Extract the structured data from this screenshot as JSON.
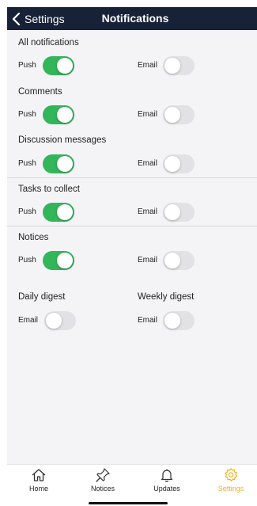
{
  "header": {
    "back_label": "Settings",
    "title": "Notifications"
  },
  "sections": [
    {
      "title": "All notifications",
      "left": {
        "label": "Push",
        "on": true
      },
      "right": {
        "label": "Email",
        "on": false
      }
    },
    {
      "title": "Comments",
      "left": {
        "label": "Push",
        "on": true
      },
      "right": {
        "label": "Email",
        "on": false
      }
    },
    {
      "title": "Discussion messages",
      "left": {
        "label": "Push",
        "on": true
      },
      "right": {
        "label": "Email",
        "on": false
      }
    },
    {
      "title": "Tasks to collect",
      "left": {
        "label": "Push",
        "on": true
      },
      "right": {
        "label": "Email",
        "on": false
      }
    },
    {
      "title": "Notices",
      "left": {
        "label": "Push",
        "on": true
      },
      "right": {
        "label": "Email",
        "on": false
      }
    }
  ],
  "digest": {
    "daily": {
      "title": "Daily digest",
      "label": "Email",
      "on": false
    },
    "weekly": {
      "title": "Weekly digest",
      "label": "Email",
      "on": false
    }
  },
  "tabbar": [
    {
      "label": "Home",
      "icon": "home-icon",
      "active": false
    },
    {
      "label": "Notices",
      "icon": "pin-icon",
      "active": false
    },
    {
      "label": "Updates",
      "icon": "bell-icon",
      "active": false
    },
    {
      "label": "Settings",
      "icon": "gear-icon",
      "active": true
    }
  ],
  "colors": {
    "header_bg": "#172238",
    "toggle_on": "#33b55a",
    "toggle_off": "#e2e2e6",
    "active_tab": "#f2b01e",
    "content_bg": "#f4f4f7"
  }
}
